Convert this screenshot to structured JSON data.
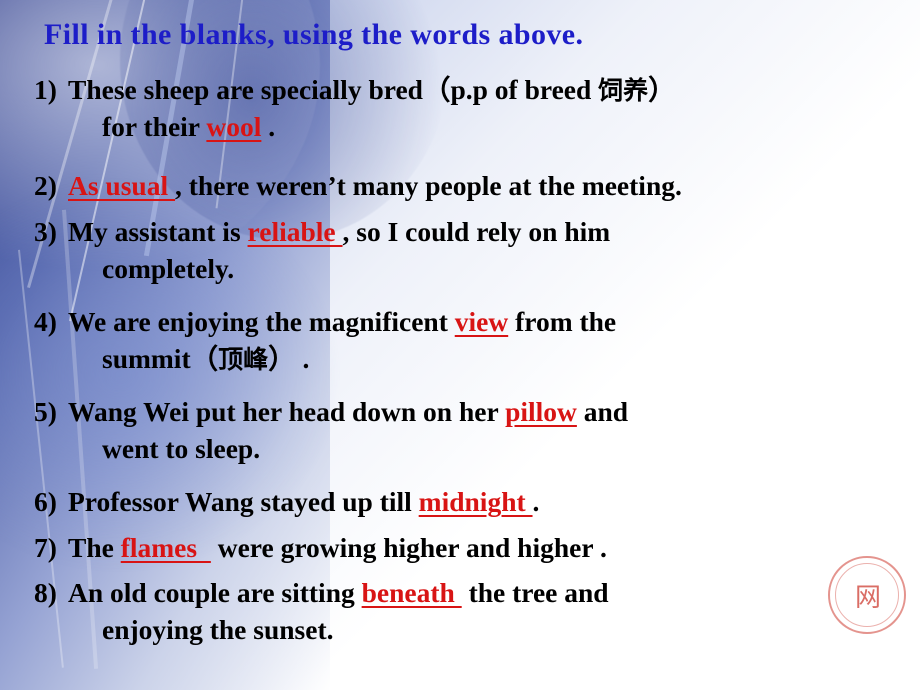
{
  "slide": {
    "title": "Fill in the blanks, using the words above.",
    "title_color": "#1d1dc8",
    "answer_color": "#d81414",
    "watermark": "网",
    "items": [
      {
        "number": "1)",
        "line1_before": "These sheep are specially bred（p.p  of breed ",
        "line1_cn": "饲养",
        "line1_after": "）",
        "line2_before": "for their ",
        "answer": "wool",
        "line2_after": " ."
      },
      {
        "number": "2)",
        "before": " ",
        "answer": "As usual ",
        "after": ", there weren’t many people at the meeting."
      },
      {
        "number": "3)",
        "before": "My assistant is ",
        "answer": "reliable ",
        "after": ", so I could rely on him",
        "line2": "completely."
      },
      {
        "number": "4)",
        "before": "We are enjoying the magnificent ",
        "answer": "view",
        "after": " from the",
        "line2_before": "summit（",
        "line2_cn": "顶峰",
        "line2_after": "） ."
      },
      {
        "number": "5)",
        "before": "Wang  Wei   put   her   head   down   on   her ",
        "answer": "pillow",
        "after": " and",
        "line2": "went to sleep."
      },
      {
        "number": "6)",
        "before": "Professor   Wang   stayed   up   till  ",
        "answer": "midnight ",
        "after": "."
      },
      {
        "number": "7)",
        "before": "The ",
        "answer": "flames  ",
        "after": "  were growing higher and  higher ."
      },
      {
        "number": "8)",
        "before": "An  old  couple  are  sitting ",
        "answer": "beneath ",
        "after": " the   tree  and",
        "line2": "enjoying the sunset."
      }
    ]
  }
}
